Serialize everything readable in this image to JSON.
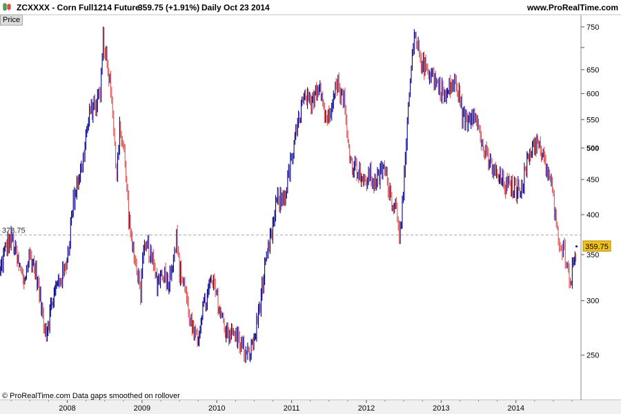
{
  "header": {
    "symbol_title": "ZCXXXX - Corn Full1214 Future",
    "price_change": "359.75 (+1.91%)",
    "period_date": "Daily  Oct 23 2014",
    "website": "www.ProRealTime.com"
  },
  "panel": {
    "tab_label": "Price"
  },
  "footer": {
    "note": "© ProRealTime.com  Data gaps smoothed on rollover"
  },
  "colors": {
    "up": "#00008b",
    "down": "#e05050",
    "price_tag": "#f0c020",
    "reference_line": "#aaaaaa"
  },
  "chart_data": {
    "type": "line",
    "title": "ZCXXXX - Corn Full1214 Future",
    "y_scale": "log",
    "ylim": [
      215,
      780
    ],
    "xlim": [
      2007.1,
      2014.87
    ],
    "y_ticks": [
      {
        "value": 250,
        "label": "250",
        "bold": false
      },
      {
        "value": 300,
        "label": "300",
        "bold": false
      },
      {
        "value": 350,
        "label": "350",
        "bold": false
      },
      {
        "value": 400,
        "label": "400",
        "bold": false
      },
      {
        "value": 450,
        "label": "450",
        "bold": false
      },
      {
        "value": 500,
        "label": "500",
        "bold": true
      },
      {
        "value": 550,
        "label": "550",
        "bold": false
      },
      {
        "value": 600,
        "label": "600",
        "bold": false
      },
      {
        "value": 650,
        "label": "650",
        "bold": false
      },
      {
        "value": 700,
        "label": "",
        "bold": false
      },
      {
        "value": 750,
        "label": "750",
        "bold": false
      }
    ],
    "x_ticks": [
      {
        "value": 2008,
        "label": "2008"
      },
      {
        "value": 2009,
        "label": "2009"
      },
      {
        "value": 2010,
        "label": "2010"
      },
      {
        "value": 2011,
        "label": "2011"
      },
      {
        "value": 2012,
        "label": "2012"
      },
      {
        "value": 2013,
        "label": "2013"
      },
      {
        "value": 2014,
        "label": "2014"
      }
    ],
    "reference_line": {
      "value": 373.75,
      "label": "373.75"
    },
    "last_price": {
      "value": 359.75,
      "label": "359.75"
    },
    "series": [
      {
        "points": [
          [
            2007.1,
            330
          ],
          [
            2007.18,
            360
          ],
          [
            2007.26,
            370
          ],
          [
            2007.34,
            340
          ],
          [
            2007.42,
            320
          ],
          [
            2007.5,
            350
          ],
          [
            2007.58,
            330
          ],
          [
            2007.66,
            290
          ],
          [
            2007.72,
            270
          ],
          [
            2007.8,
            300
          ],
          [
            2007.88,
            320
          ],
          [
            2007.96,
            330
          ],
          [
            2008.02,
            360
          ],
          [
            2008.08,
            420
          ],
          [
            2008.14,
            450
          ],
          [
            2008.2,
            470
          ],
          [
            2008.26,
            530
          ],
          [
            2008.32,
            570
          ],
          [
            2008.38,
            580
          ],
          [
            2008.44,
            600
          ],
          [
            2008.48,
            720
          ],
          [
            2008.52,
            680
          ],
          [
            2008.58,
            610
          ],
          [
            2008.62,
            520
          ],
          [
            2008.66,
            460
          ],
          [
            2008.7,
            540
          ],
          [
            2008.76,
            490
          ],
          [
            2008.82,
            400
          ],
          [
            2008.88,
            350
          ],
          [
            2008.94,
            330
          ],
          [
            2008.98,
            310
          ],
          [
            2009.02,
            350
          ],
          [
            2009.08,
            360
          ],
          [
            2009.14,
            340
          ],
          [
            2009.2,
            320
          ],
          [
            2009.28,
            330
          ],
          [
            2009.36,
            320
          ],
          [
            2009.42,
            350
          ],
          [
            2009.46,
            370
          ],
          [
            2009.5,
            330
          ],
          [
            2009.56,
            320
          ],
          [
            2009.62,
            290
          ],
          [
            2009.68,
            270
          ],
          [
            2009.74,
            260
          ],
          [
            2009.8,
            290
          ],
          [
            2009.86,
            300
          ],
          [
            2009.92,
            320
          ],
          [
            2009.98,
            310
          ],
          [
            2010.04,
            290
          ],
          [
            2010.1,
            275
          ],
          [
            2010.16,
            270
          ],
          [
            2010.22,
            268
          ],
          [
            2010.28,
            265
          ],
          [
            2010.34,
            258
          ],
          [
            2010.4,
            248
          ],
          [
            2010.46,
            255
          ],
          [
            2010.52,
            270
          ],
          [
            2010.58,
            300
          ],
          [
            2010.64,
            330
          ],
          [
            2010.7,
            360
          ],
          [
            2010.76,
            390
          ],
          [
            2010.8,
            420
          ],
          [
            2010.86,
            420
          ],
          [
            2010.92,
            430
          ],
          [
            2010.96,
            460
          ],
          [
            2011.02,
            490
          ],
          [
            2011.08,
            540
          ],
          [
            2011.14,
            580
          ],
          [
            2011.2,
            590
          ],
          [
            2011.26,
            570
          ],
          [
            2011.32,
            610
          ],
          [
            2011.38,
            620
          ],
          [
            2011.44,
            560
          ],
          [
            2011.5,
            550
          ],
          [
            2011.56,
            610
          ],
          [
            2011.62,
            620
          ],
          [
            2011.66,
            600
          ],
          [
            2011.7,
            590
          ],
          [
            2011.74,
            520
          ],
          [
            2011.8,
            475
          ],
          [
            2011.86,
            470
          ],
          [
            2011.92,
            460
          ],
          [
            2011.98,
            440
          ],
          [
            2012.04,
            460
          ],
          [
            2012.1,
            445
          ],
          [
            2012.16,
            450
          ],
          [
            2012.22,
            470
          ],
          [
            2012.28,
            450
          ],
          [
            2012.34,
            420
          ],
          [
            2012.4,
            410
          ],
          [
            2012.44,
            380
          ],
          [
            2012.48,
            410
          ],
          [
            2012.52,
            470
          ],
          [
            2012.56,
            570
          ],
          [
            2012.6,
            650
          ],
          [
            2012.64,
            720
          ],
          [
            2012.68,
            700
          ],
          [
            2012.72,
            680
          ],
          [
            2012.76,
            660
          ],
          [
            2012.82,
            650
          ],
          [
            2012.88,
            640
          ],
          [
            2012.94,
            620
          ],
          [
            2013.0,
            610
          ],
          [
            2013.06,
            590
          ],
          [
            2013.12,
            615
          ],
          [
            2013.18,
            620
          ],
          [
            2013.24,
            600
          ],
          [
            2013.28,
            560
          ],
          [
            2013.34,
            545
          ],
          [
            2013.4,
            560
          ],
          [
            2013.46,
            570
          ],
          [
            2013.5,
            530
          ],
          [
            2013.56,
            500
          ],
          [
            2013.62,
            480
          ],
          [
            2013.68,
            470
          ],
          [
            2013.74,
            455
          ],
          [
            2013.8,
            450
          ],
          [
            2013.86,
            440
          ],
          [
            2013.92,
            440
          ],
          [
            2013.98,
            438
          ],
          [
            2014.04,
            435
          ],
          [
            2014.1,
            450
          ],
          [
            2014.16,
            480
          ],
          [
            2014.22,
            505
          ],
          [
            2014.28,
            510
          ],
          [
            2014.34,
            490
          ],
          [
            2014.4,
            470
          ],
          [
            2014.46,
            450
          ],
          [
            2014.5,
            420
          ],
          [
            2014.54,
            380
          ],
          [
            2014.58,
            370
          ],
          [
            2014.62,
            360
          ],
          [
            2014.66,
            350
          ],
          [
            2014.7,
            330
          ],
          [
            2014.74,
            325
          ],
          [
            2014.78,
            345
          ],
          [
            2014.81,
            359.75
          ]
        ]
      }
    ]
  }
}
